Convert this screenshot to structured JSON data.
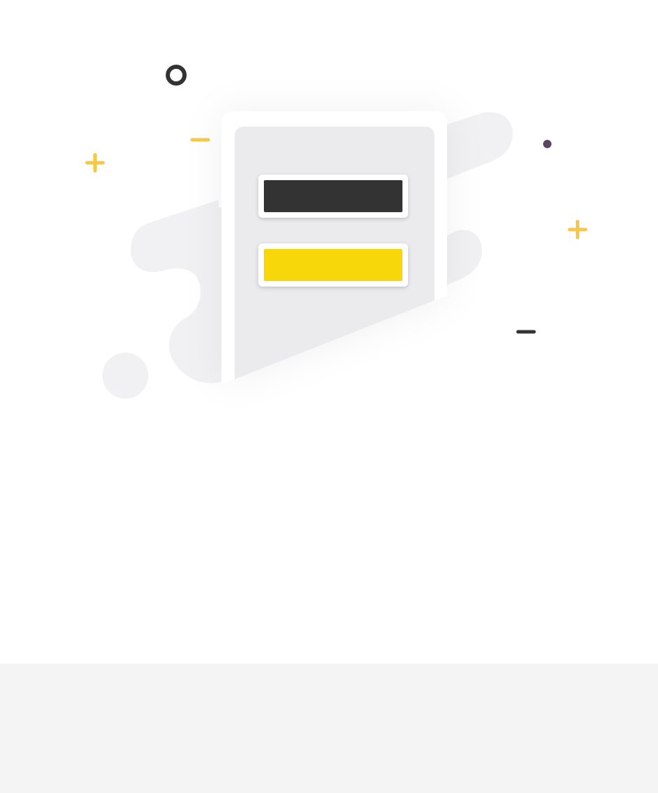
{
  "illustration": {
    "kind": "empty-state illustration",
    "colors": {
      "background": "#ffffff",
      "blob": "#f1f1f4",
      "phone_frame": "#ffffff",
      "phone_screen": "#ebebee",
      "dark_button": "#333333",
      "accent_button": "#f8d70a",
      "sparkle_yellow": "#f5c84a",
      "sparkle_dark": "#333333",
      "sparkle_purple": "#5a4664"
    },
    "icons": [
      "phone-icon",
      "plus-icon",
      "minus-icon",
      "ring-icon",
      "dot-icon"
    ]
  },
  "footer": {
    "color": "#f4f4f4"
  }
}
